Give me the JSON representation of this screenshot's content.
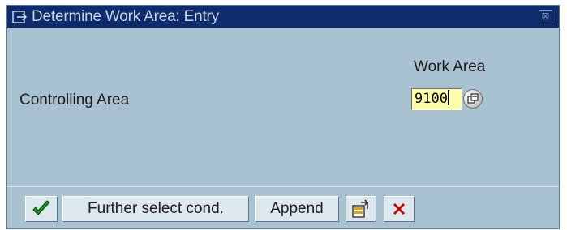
{
  "window": {
    "title": "Determine Work Area: Entry",
    "close_symbol": "⊠"
  },
  "form": {
    "column_header": "Work Area",
    "field_label": "Controlling Area",
    "field_value": "9100"
  },
  "toolbar": {
    "further_label": "Further select cond.",
    "append_label": "Append"
  },
  "icons": {
    "title": "dialog-arrow-icon",
    "close": "close-icon",
    "f4": "value-help-icon",
    "check": "checkmark-icon",
    "multi": "multiple-selection-icon",
    "cancel": "cancel-icon"
  },
  "colors": {
    "titlebar": "#0e2c6c",
    "body": "#a8c2d2",
    "input_bg": "#ffffaa",
    "check": "#1f8f1f",
    "cancel": "#cc0000"
  }
}
